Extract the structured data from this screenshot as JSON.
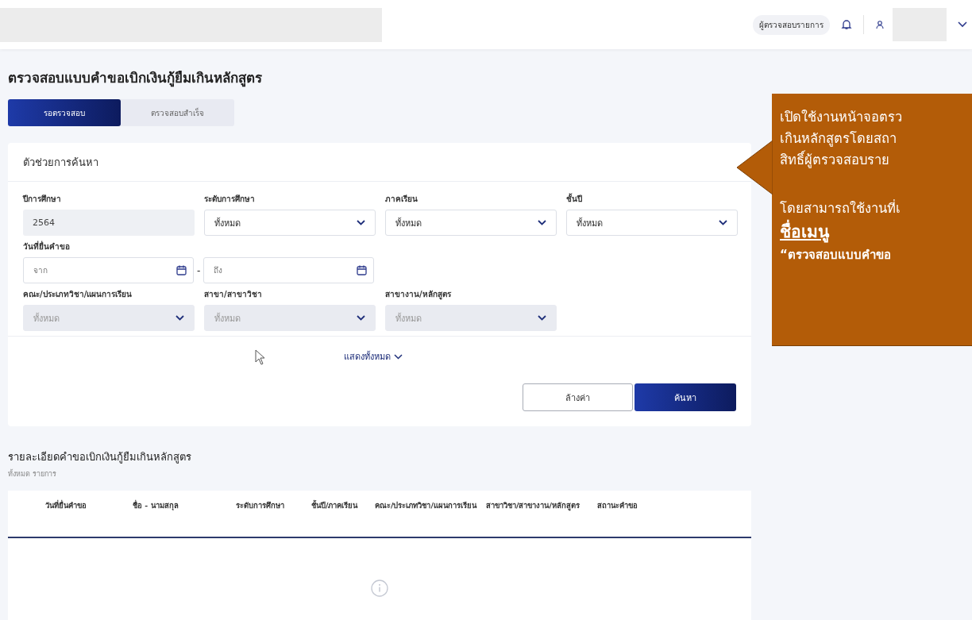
{
  "topbar": {
    "role": "ผู้ตรวจสอบรายการ"
  },
  "page_title": "ตรวจสอบแบบคำขอเบิกเงินกู้ยืมเกินหลักสูตร",
  "tabs": [
    {
      "label": "รอตรวจสอบ",
      "selected": true
    },
    {
      "label": "ตรวจสอบสำเร็จ",
      "selected": false
    }
  ],
  "search": {
    "title": "ตัวช่วยการค้นหา",
    "rows": [
      [
        {
          "label": "ปีการศึกษา",
          "kind": "readonly",
          "value": "2564"
        },
        {
          "label": "ระดับการศึกษา",
          "kind": "select",
          "value": "ทั้งหมด",
          "disabled": false
        },
        {
          "label": "ภาคเรียน",
          "kind": "select",
          "value": "ทั้งหมด",
          "disabled": false
        },
        {
          "label": "ชั้นปี",
          "kind": "select",
          "value": "ทั้งหมด",
          "disabled": false
        }
      ],
      [
        {
          "label": "วันที่ยื่นคำขอ",
          "kind": "daterange",
          "from_placeholder": "จาก",
          "to_placeholder": "ถึง",
          "separator": "-"
        }
      ],
      [
        {
          "label": "คณะ/ประเภทวิชา/แผนการเรียน",
          "kind": "select",
          "value": "ทั้งหมด",
          "disabled": true
        },
        {
          "label": "สาขา/สาขาวิชา",
          "kind": "select",
          "value": "ทั้งหมด",
          "disabled": true
        },
        {
          "label": "สาขางาน/หลักสูตร",
          "kind": "select",
          "value": "ทั้งหมด",
          "disabled": true
        }
      ]
    ],
    "show_all": "แสดงทั้งหมด",
    "buttons": [
      {
        "label": "ล้างค่า",
        "kind": "outline"
      },
      {
        "label": "ค้นหา",
        "kind": "primary"
      }
    ]
  },
  "results": {
    "title": "รายละเอียดคำขอเบิกเงินกู้ยืมเกินหลักสูตร",
    "count": "ทั้งหมด รายการ",
    "columns": [
      "วันที่ยื่นคำขอ",
      "ชื่อ - นามสกุล",
      "ระดับการศึกษา",
      "ชั้นปี/ภาคเรียน",
      "คณะ/ประเภทวิชา/แผนการเรียน",
      "สาขาวิชา/สาขางาน/หลักสูตร",
      "สถานะคำขอ"
    ]
  },
  "callout": {
    "lines": [
      {
        "kind": "body",
        "text": "เปิดใช้งานหน้าจอตรว"
      },
      {
        "kind": "body",
        "text": "เกินหลักสูตรโดยสถา"
      },
      {
        "kind": "body",
        "text": "สิทธิ์ผู้ตรวจสอบราย"
      },
      {
        "kind": "gap_body",
        "text": "โดยสามารถใช้งานที่เ"
      },
      {
        "kind": "heading",
        "text": "ชื่อเมนู"
      },
      {
        "kind": "quote",
        "text": "“ตรวจสอบแบบคำขอ"
      }
    ]
  }
}
